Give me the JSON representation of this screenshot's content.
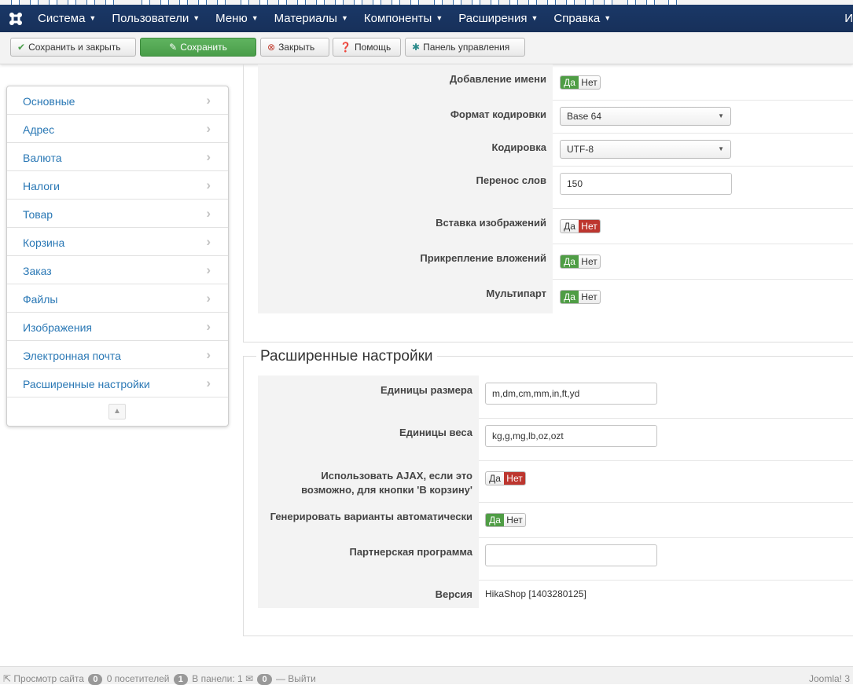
{
  "navbar": {
    "items": [
      {
        "label": "Система"
      },
      {
        "label": "Пользователи"
      },
      {
        "label": "Меню"
      },
      {
        "label": "Материалы"
      },
      {
        "label": "Компоненты"
      },
      {
        "label": "Расширения"
      },
      {
        "label": "Справка"
      }
    ],
    "right_label": "И"
  },
  "toolbar": {
    "save_close": "Сохранить и закрыть",
    "save": "Сохранить",
    "close": "Закрыть",
    "help": "Помощь",
    "control_panel": "Панель управления"
  },
  "sidebar": {
    "items": [
      {
        "label": "Основные"
      },
      {
        "label": "Адрес"
      },
      {
        "label": "Валюта"
      },
      {
        "label": "Налоги"
      },
      {
        "label": "Товар"
      },
      {
        "label": "Корзина"
      },
      {
        "label": "Заказ"
      },
      {
        "label": "Файлы"
      },
      {
        "label": "Изображения"
      },
      {
        "label": "Электронная почта"
      },
      {
        "label": "Расширенные настройки"
      }
    ]
  },
  "upper": {
    "add_name": {
      "label": "Добавление имени",
      "yes": "Да",
      "no": "Нет",
      "value": "yes"
    },
    "encoding_format": {
      "label": "Формат кодировки",
      "value": "Base 64"
    },
    "charset": {
      "label": "Кодировка",
      "value": "UTF-8"
    },
    "word_wrap": {
      "label": "Перенос слов",
      "value": "150"
    },
    "embed_images": {
      "label": "Вставка изображений",
      "yes": "Да",
      "no": "Нет",
      "value": "no"
    },
    "attach_files": {
      "label": "Прикрепление вложений",
      "yes": "Да",
      "no": "Нет",
      "value": "yes"
    },
    "multipart": {
      "label": "Мультипарт",
      "yes": "Да",
      "no": "Нет",
      "value": "yes"
    }
  },
  "advanced": {
    "legend": "Расширенные настройки",
    "size_units": {
      "label": "Единицы размера",
      "value": "m,dm,cm,mm,in,ft,yd"
    },
    "weight_units": {
      "label": "Единицы веса",
      "value": "kg,g,mg,lb,oz,ozt"
    },
    "ajax_line1": "Использовать AJAX, если это",
    "ajax_line2": "возможно, для кнопки 'В корзину'",
    "ajax": {
      "yes": "Да",
      "no": "Нет",
      "value": "no"
    },
    "variants": {
      "label": "Генерировать варианты автоматически",
      "yes": "Да",
      "no": "Нет",
      "value": "yes"
    },
    "affiliate": {
      "label": "Партнерская программа",
      "value": ""
    },
    "version": {
      "label": "Версия",
      "value": "HikaShop [1403280125]"
    }
  },
  "statusbar": {
    "view_site": "Просмотр сайта",
    "visitors_count": "0",
    "visitors_label": "0 посетителей",
    "admin_count": "1",
    "admin_label": "В панели: 1",
    "messages_count": "0",
    "logout": "Выйти",
    "brand": "Joomla! 3"
  },
  "colors": {
    "navbar": "#1a3867",
    "green": "#4f9d45",
    "red": "#bd362f",
    "link": "#2a78b5"
  }
}
